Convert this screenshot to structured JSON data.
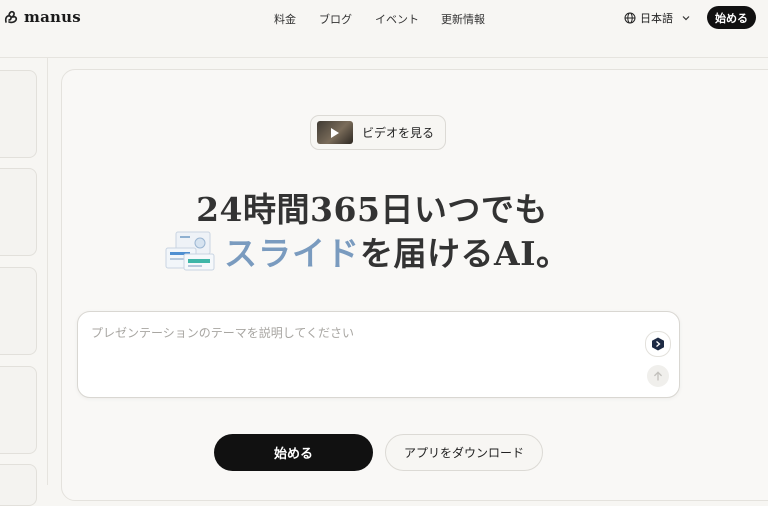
{
  "header": {
    "logo_text": "manus",
    "nav": [
      {
        "label": "料金"
      },
      {
        "label": "ブログ"
      },
      {
        "label": "イベント"
      },
      {
        "label": "更新情報"
      }
    ],
    "language": "日本語",
    "start_label": "始める"
  },
  "hero": {
    "video_label": "ビデオを見る",
    "headline_line1": "24時間365日いつでも",
    "headline_accent": "スライド",
    "headline_rest": "を届けるAI。"
  },
  "prompt": {
    "placeholder": "プレゼンテーションのテーマを説明してください"
  },
  "actions": {
    "start_label": "始める",
    "download_label": "アプリをダウンロード"
  }
}
